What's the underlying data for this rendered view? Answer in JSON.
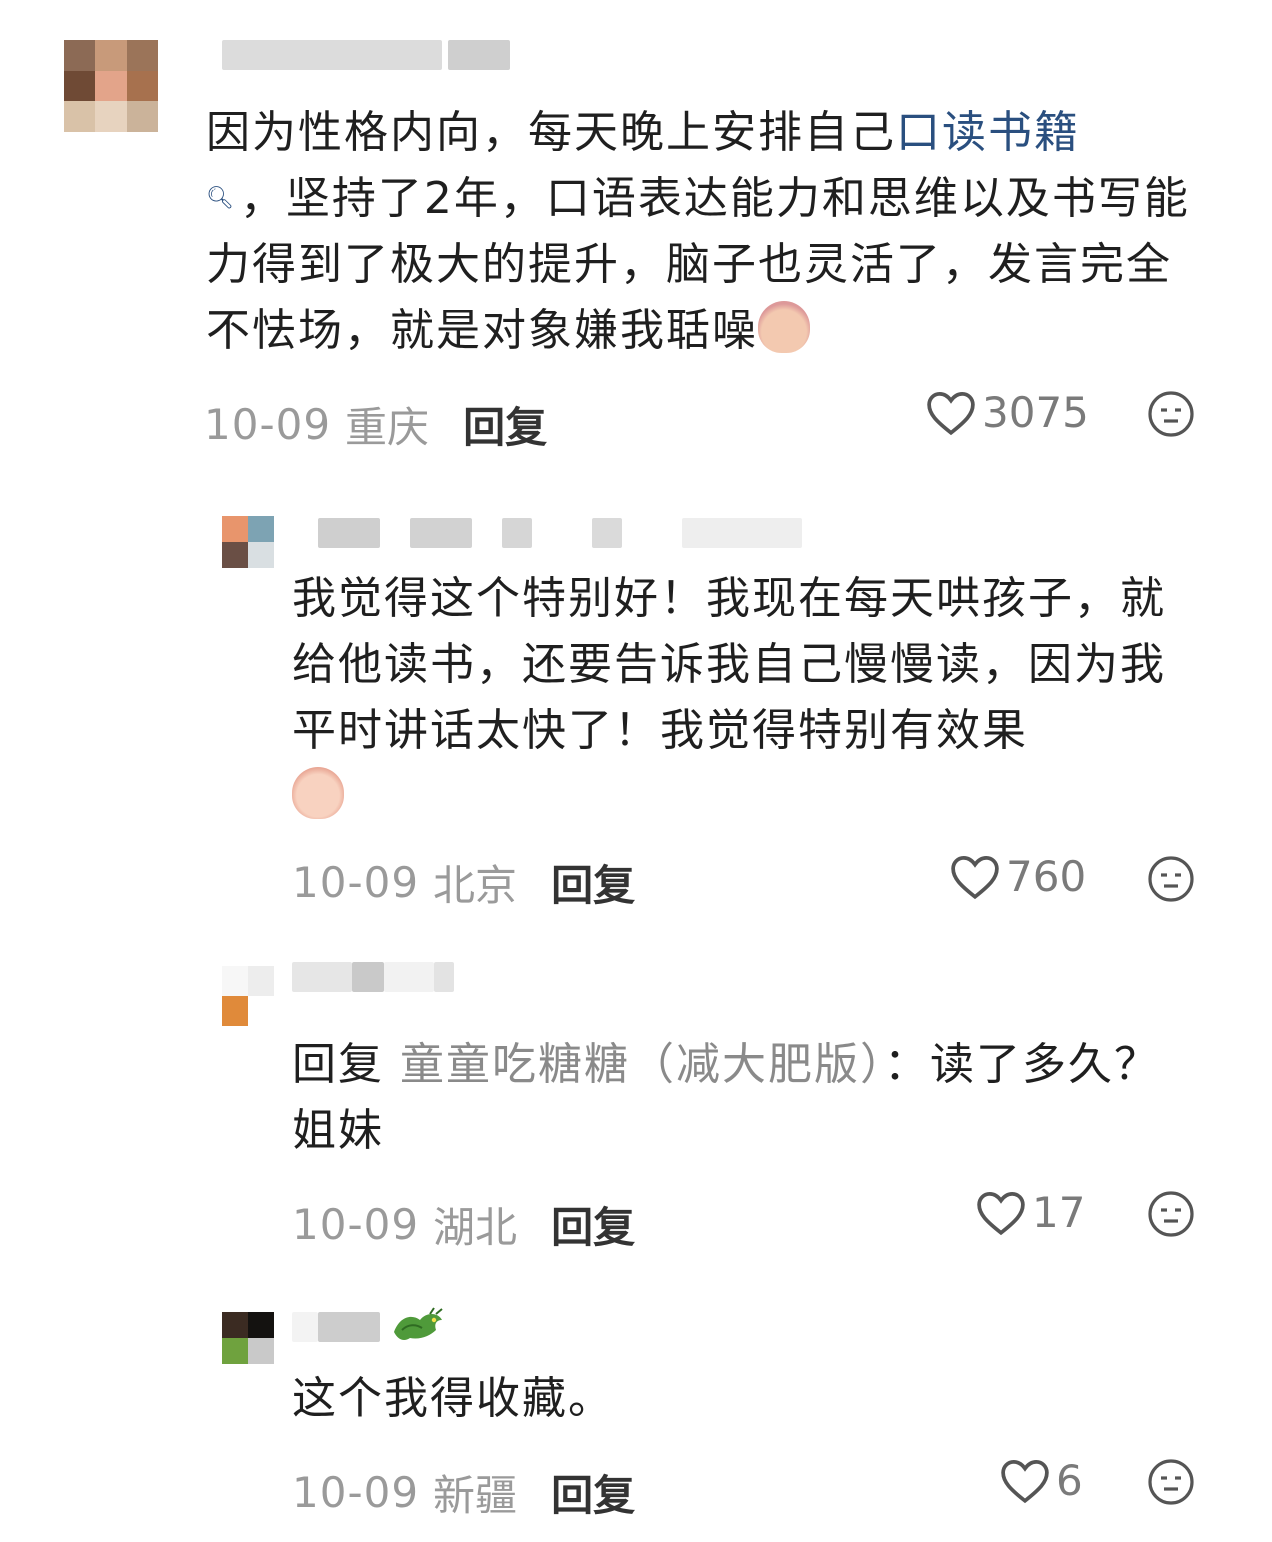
{
  "comments": [
    {
      "text_before_link": "因为性格内向，每天晚上安排自己",
      "link_text": "口读书籍",
      "text_after_link": "，坚持了2年，口语表达能力和思维以及书写能力得到了极大的提升，脑子也灵活了，发言完全不怯场，就是对象嫌我聒噪",
      "date": "10-09",
      "location": "重庆",
      "reply_label": "回复",
      "likes": "3075",
      "emoji": "potato-smirk-emoji"
    },
    {
      "text": "我觉得这个特别好！我现在每天哄孩子，就给他读书，还要告诉我自己慢慢读，因为我平时讲话太快了！我觉得特别有效果",
      "date": "10-09",
      "location": "北京",
      "reply_label": "回复",
      "likes": "760",
      "emoji": "crying-laughing-emoji"
    },
    {
      "reply_prefix": "回复",
      "reply_target": "童童吃糖糖（减大肥版）",
      "reply_colon": "：",
      "text": "读了多久？姐妹",
      "date": "10-09",
      "location": "湖北",
      "reply_label": "回复",
      "likes": "17"
    },
    {
      "text": "这个我得收藏。",
      "date": "10-09",
      "location": "新疆",
      "reply_label": "回复",
      "likes": "6",
      "name_badge": "dragon-icon"
    }
  ],
  "colors": {
    "link": "#2a4f7f",
    "meta": "#9a9a9a",
    "text": "#1f1f1f"
  }
}
